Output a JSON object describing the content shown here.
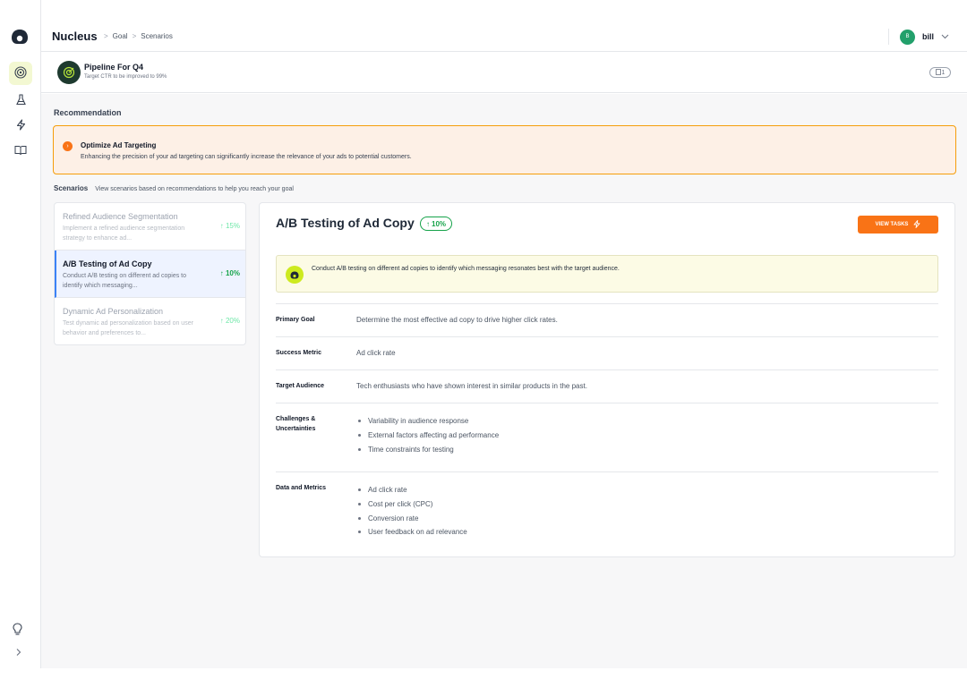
{
  "header": {
    "brand": "Nucleus",
    "breadcrumb": [
      "Goal",
      "Scenarios"
    ],
    "breadcrumb_sep": ">",
    "user_initials": "B",
    "user_name": "bill"
  },
  "goal": {
    "title": "Pipeline For Q4",
    "subtitle": "Target CTR to be improved to 99%",
    "badge_count": "1"
  },
  "recommendation": {
    "section_label": "Recommendation",
    "title": "Optimize Ad Targeting",
    "description": "Enhancing the precision of your ad targeting can significantly increase the relevance of your ads to potential customers."
  },
  "scenarios": {
    "title": "Scenarios",
    "subtitle": "View scenarios based on recommendations to help you reach your goal",
    "items": [
      {
        "name": "Refined Audience Segmentation",
        "desc": "Implement a refined audience segmentation strategy to enhance ad...",
        "pct": "15%",
        "active": false
      },
      {
        "name": "A/B Testing of Ad Copy",
        "desc": "Conduct A/B testing on different ad copies to identify which messaging...",
        "pct": "10%",
        "active": true
      },
      {
        "name": "Dynamic Ad Personalization",
        "desc": "Test dynamic ad personalization based on user behavior and preferences to...",
        "pct": "20%",
        "active": false
      }
    ]
  },
  "detail": {
    "title": "A/B Testing of Ad Copy",
    "pct": "10%",
    "view_tasks_label": "VIEW TASKS",
    "callout": "Conduct A/B testing on different ad copies to identify which messaging resonates best with the target audience.",
    "primary_goal_label": "Primary Goal",
    "primary_goal": "Determine the most effective ad copy to drive higher click rates.",
    "success_metric_label": "Success Metric",
    "success_metric": "Ad click rate",
    "target_audience_label": "Target Audience",
    "target_audience": "Tech enthusiasts who have shown interest in similar products in the past.",
    "challenges_label": "Challenges & Uncertainties",
    "challenges": [
      "Variability in audience response",
      "External factors affecting ad performance",
      "Time constraints for testing"
    ],
    "data_label": "Data and Metrics",
    "data_metrics": [
      "Ad click rate",
      "Cost per click (CPC)",
      "Conversion rate",
      "User feedback on ad relevance"
    ]
  },
  "colors": {
    "accent": "#f97316",
    "success": "#16a34a",
    "active_item": "#3b82f6",
    "lime": "#cdea1f"
  },
  "icons": {
    "logo": "nucleus-logo-icon",
    "nav": [
      "target-icon",
      "flask-icon",
      "bolt-icon",
      "book-icon"
    ],
    "bottom": [
      "lightbulb-icon",
      "chevron-right-icon"
    ]
  }
}
